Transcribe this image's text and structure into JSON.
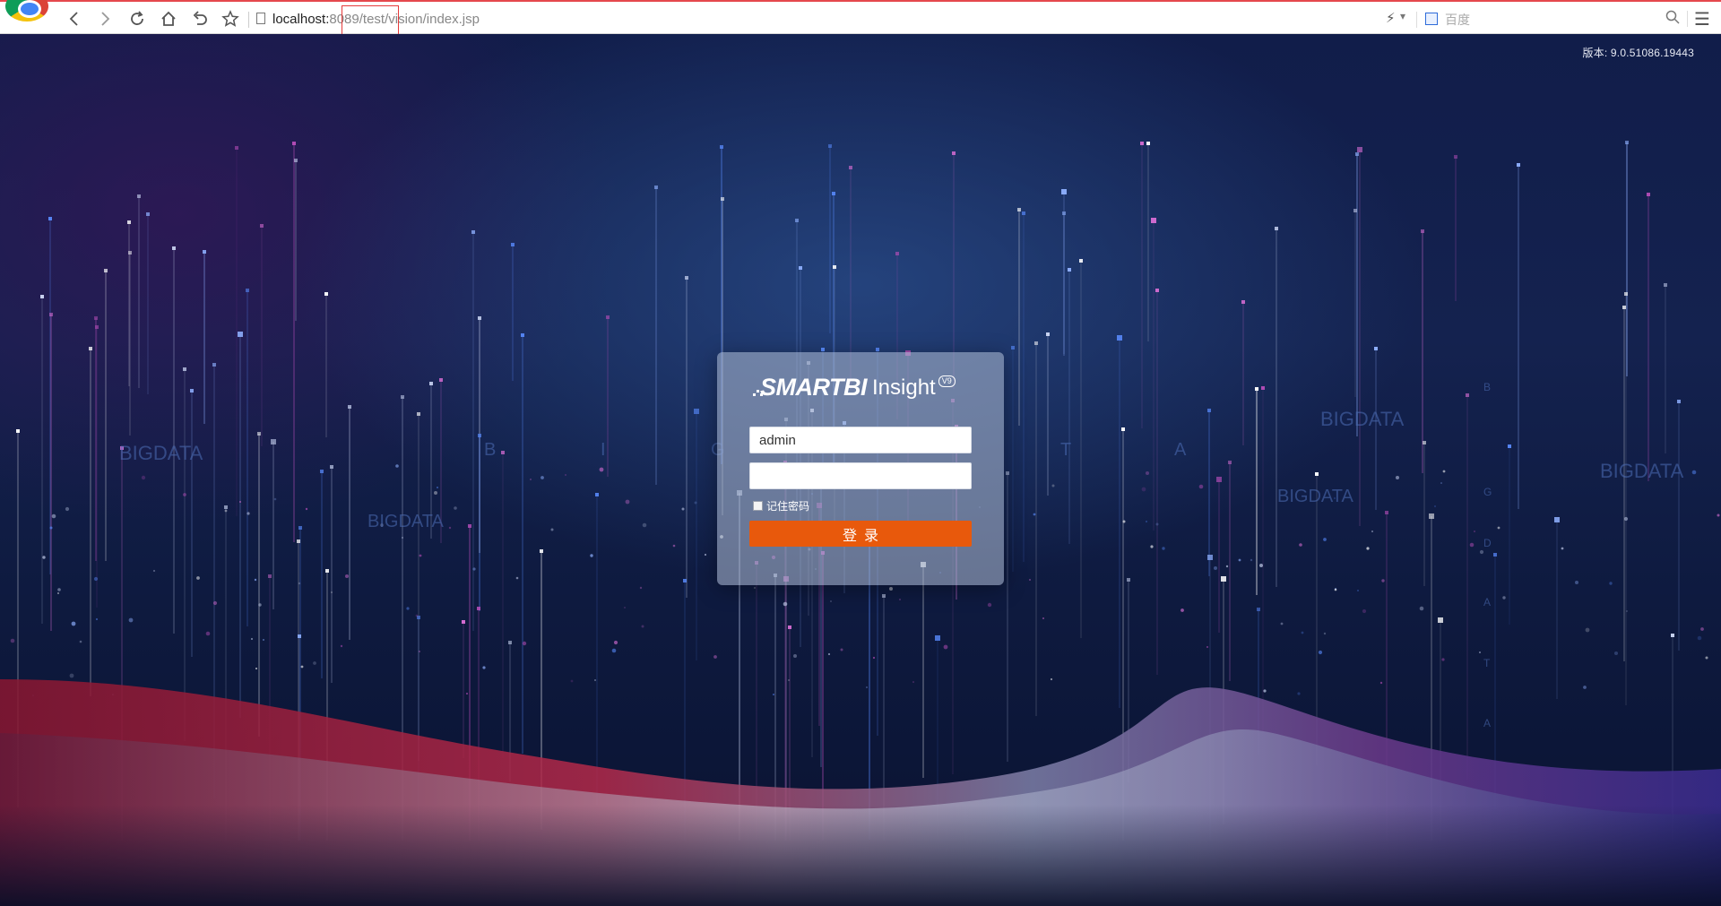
{
  "browser": {
    "url_host": "localhost:",
    "url_rest": "8089/test/vision/index.jsp",
    "search_engine_label": "百度"
  },
  "page": {
    "version_label": "版本: 9.0.51086.19443",
    "background_words": [
      "BIGDATA",
      "B",
      "I",
      "G",
      "T",
      "A",
      "BIGDATA",
      "BIGDATA",
      "BIGDATA",
      "BIGDATA",
      "B",
      "G",
      "D",
      "A",
      "T",
      "A"
    ]
  },
  "login": {
    "brand": "SMARTBI",
    "product": "Insight",
    "badge": "V9",
    "username_value": "admin",
    "password_value": "",
    "remember_label": "记住密码",
    "remember_checked": false,
    "submit_label": "登录",
    "accent_color": "#e8590c"
  },
  "icons": [
    "browser-logo-icon",
    "back-icon",
    "forward-icon",
    "reload-icon",
    "home-icon",
    "undo-icon",
    "star-icon",
    "page-icon",
    "bolt-icon",
    "chevron-down-icon",
    "baidu-icon",
    "search-icon",
    "menu-icon"
  ]
}
